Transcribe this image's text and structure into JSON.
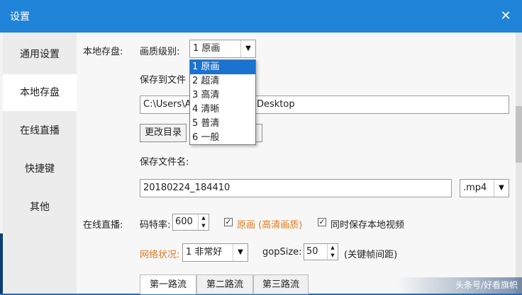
{
  "window": {
    "title": "设置",
    "close_label": "✕"
  },
  "sidebar": {
    "items": [
      {
        "label": "通用设置",
        "active": false
      },
      {
        "label": "本地存盘",
        "active": true
      },
      {
        "label": "在线直播",
        "active": false
      },
      {
        "label": "快捷键",
        "active": false
      },
      {
        "label": "其他",
        "active": false
      }
    ]
  },
  "local_storage": {
    "section_label": "本地存盘:",
    "quality_label": "画质级别:",
    "quality_value": "1 原画",
    "save_to_label": "保存到文件",
    "path_prefix": "C:\\Users\\A",
    "path_suffix": "Desktop",
    "change_dir_button": "更改目录",
    "filename_label": "保存文件名:",
    "filename_value": "20180224_184410",
    "format_value": ".mp4"
  },
  "quality_dropdown": {
    "options": [
      "1 原画",
      "2 超清",
      "3 高清",
      "4 清晰",
      "5 普清",
      "6 一般"
    ],
    "selected_index": 0
  },
  "live": {
    "section_label": "在线直播:",
    "bitrate_label": "码特率:",
    "bitrate_value": "600",
    "original_checkbox_label": "原画 (高清画质)",
    "original_checked": true,
    "save_local_label": "同时保存本地视频",
    "save_local_checked": true,
    "network_label": "网络状况:",
    "network_value": "1  非常好",
    "gop_label": "gopSize:",
    "gop_value": "50",
    "gop_note": "(关键帧间距)",
    "tabs": [
      "第一路流",
      "第二路流",
      "第三路流"
    ]
  },
  "watermark": "头条号/好看旗帜",
  "colors": {
    "titlebar": "#1f84d8",
    "accent_orange": "#e07a1f",
    "selection": "#1a72d1"
  },
  "icons": {
    "close": "close-icon",
    "dropdown": "chevron-down-icon",
    "spinner": "spinner-arrows-icon",
    "check": "checkmark-icon"
  }
}
